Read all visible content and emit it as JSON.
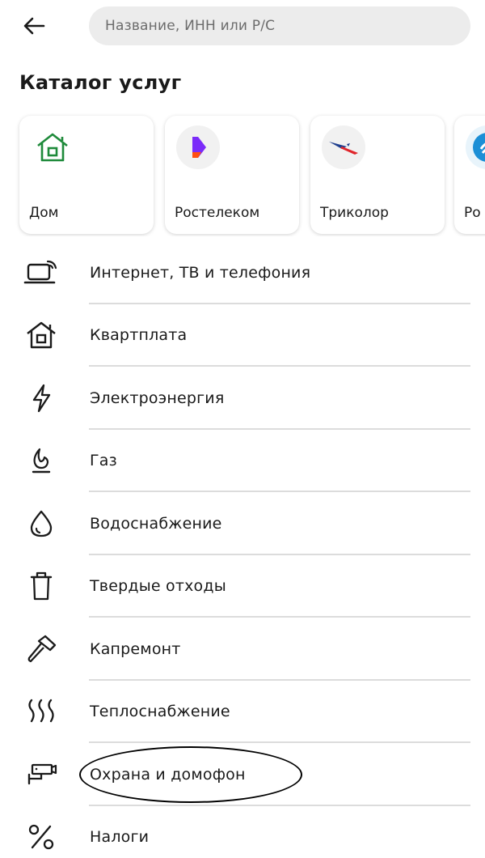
{
  "search": {
    "placeholder": "Название, ИНН или Р/С"
  },
  "catalog": {
    "title": "Каталог услуг"
  },
  "cards": [
    {
      "label": "Дом",
      "icon": "home-icon"
    },
    {
      "label": "Ростелеком",
      "icon": "rostelecom-logo"
    },
    {
      "label": "Триколор",
      "icon": "tricolor-logo"
    },
    {
      "label": "Ро",
      "icon": "partial-logo"
    }
  ],
  "categories": [
    {
      "label": "Интернет, ТВ и телефония",
      "icon": "laptop-wifi-icon"
    },
    {
      "label": "Квартплата",
      "icon": "house-icon"
    },
    {
      "label": "Электроэнергия",
      "icon": "lightning-icon"
    },
    {
      "label": "Газ",
      "icon": "gas-flame-icon"
    },
    {
      "label": "Водоснабжение",
      "icon": "water-drop-icon"
    },
    {
      "label": "Твердые отходы",
      "icon": "trash-icon"
    },
    {
      "label": "Капремонт",
      "icon": "hammer-icon"
    },
    {
      "label": "Теплоснабжение",
      "icon": "heat-waves-icon"
    },
    {
      "label": "Охрана и домофон",
      "icon": "security-camera-icon"
    },
    {
      "label": "Налоги",
      "icon": "percent-icon"
    }
  ],
  "colors": {
    "home_icon": "#1e8a3a",
    "rostelecom_purple": "#7b2bf9",
    "rostelecom_orange": "#ff4f12",
    "tricolor_blue": "#1f3f8f",
    "tricolor_red": "#e0252b"
  }
}
